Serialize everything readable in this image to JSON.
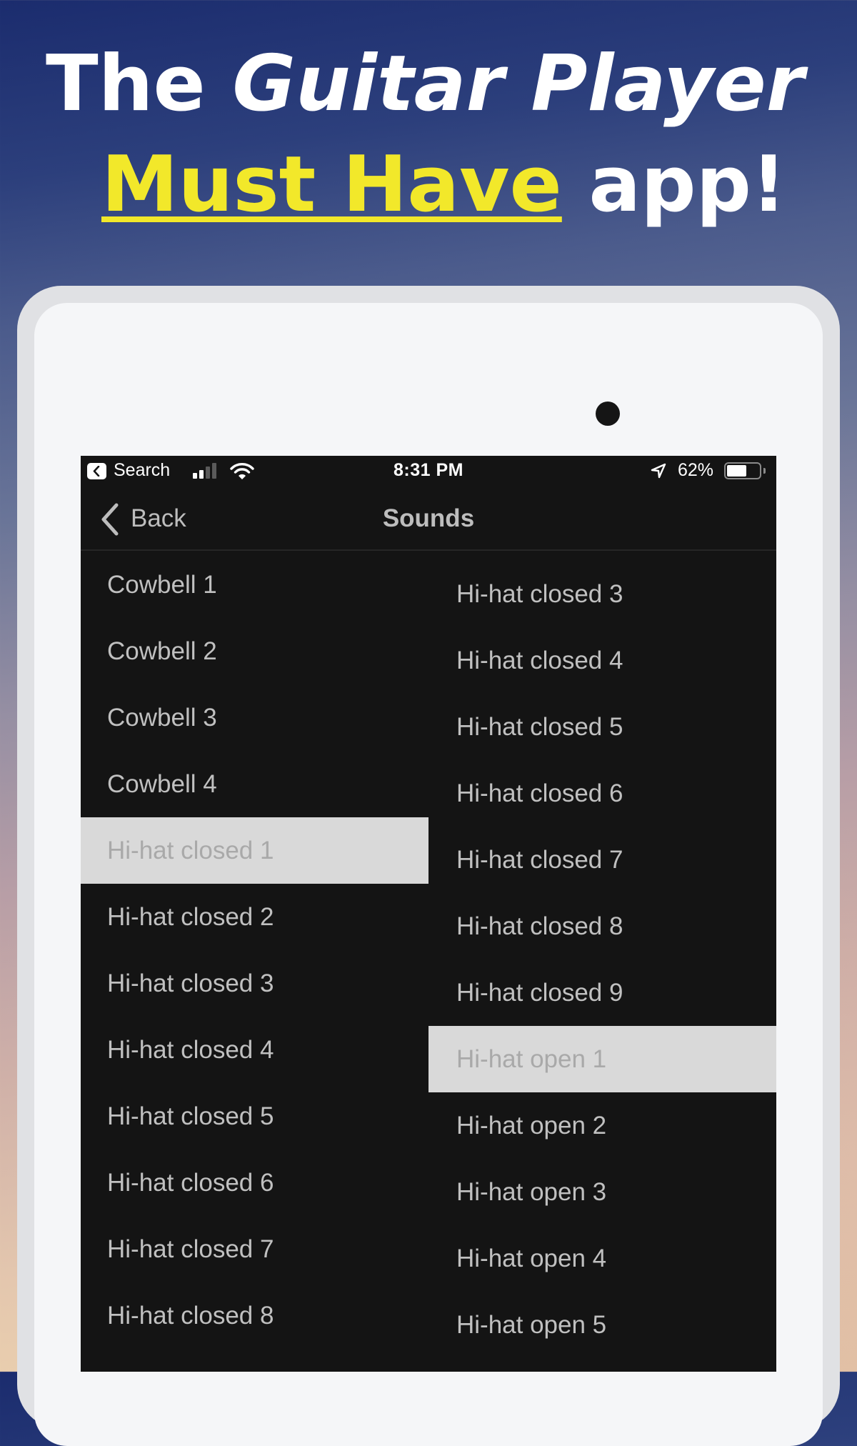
{
  "headline": {
    "line1_prefix": "The ",
    "line1_emphasis": "Guitar Player",
    "line2_highlight": "Must Have",
    "line2_suffix": " app!",
    "highlight_color": "#f2e82a"
  },
  "status_bar": {
    "back_app_label": "Search",
    "time": "8:31 PM",
    "battery_percent_label": "62%",
    "battery_level": 0.62,
    "signal_bars_active": 2,
    "signal_bars_total": 4,
    "icons": [
      "back-to-app-icon",
      "signal-icon",
      "wifi-icon",
      "location-arrow-icon",
      "battery-icon"
    ]
  },
  "nav": {
    "back_label": "Back",
    "title": "Sounds"
  },
  "sounds": {
    "left_column": [
      {
        "label": "Cowbell 1",
        "selected": false
      },
      {
        "label": "Cowbell 2",
        "selected": false
      },
      {
        "label": "Cowbell 3",
        "selected": false
      },
      {
        "label": "Cowbell 4",
        "selected": false
      },
      {
        "label": "Hi-hat closed 1",
        "selected": true
      },
      {
        "label": "Hi-hat closed 2",
        "selected": false
      },
      {
        "label": "Hi-hat closed 3",
        "selected": false
      },
      {
        "label": "Hi-hat closed 4",
        "selected": false
      },
      {
        "label": "Hi-hat closed 5",
        "selected": false
      },
      {
        "label": "Hi-hat closed 6",
        "selected": false
      },
      {
        "label": "Hi-hat closed 7",
        "selected": false
      },
      {
        "label": "Hi-hat closed 8",
        "selected": false
      }
    ],
    "right_column": [
      {
        "label": "Hi-hat closed 3",
        "selected": false
      },
      {
        "label": "Hi-hat closed 4",
        "selected": false
      },
      {
        "label": "Hi-hat closed 5",
        "selected": false
      },
      {
        "label": "Hi-hat closed 6",
        "selected": false
      },
      {
        "label": "Hi-hat closed 7",
        "selected": false
      },
      {
        "label": "Hi-hat closed 8",
        "selected": false
      },
      {
        "label": "Hi-hat closed 9",
        "selected": false
      },
      {
        "label": "Hi-hat open 1",
        "selected": true
      },
      {
        "label": "Hi-hat open 2",
        "selected": false
      },
      {
        "label": "Hi-hat open 3",
        "selected": false
      },
      {
        "label": "Hi-hat open 4",
        "selected": false
      },
      {
        "label": "Hi-hat open 5",
        "selected": false
      }
    ]
  },
  "colors": {
    "screen_bg": "#141414",
    "row_text": "#c0c0c0",
    "selected_bg": "#d9d9d9",
    "selected_text": "#a9a9a9"
  }
}
